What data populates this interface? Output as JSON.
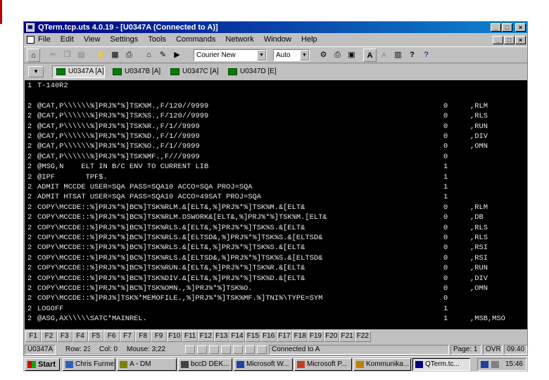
{
  "window": {
    "title": "QTerm.tcp.uts 4.0.19 - [U0347A (Connected to A)]",
    "menu": [
      "File",
      "Edit",
      "View",
      "Settings",
      "Tools",
      "Commands",
      "Network",
      "Window",
      "Help"
    ]
  },
  "toolbar": {
    "font_select": "Courier New",
    "size_select": "Auto"
  },
  "tabs": [
    "U0347A [A]",
    "U0347B [A]",
    "U0347C [A]",
    "U0347D [E]"
  ],
  "terminal_lines": [
    {
      "ln": "1",
      "cmd": "T-140R2",
      "c1": "",
      "c2": ""
    },
    {
      "ln": "",
      "cmd": "",
      "c1": "",
      "c2": ""
    },
    {
      "ln": "2",
      "cmd": "@CAT,P\\\\\\\\\\\\%]PRJ%*%]TSK%M.,F/120//9999",
      "c1": "0",
      "c2": ",RLM"
    },
    {
      "ln": "2",
      "cmd": "@CAT,P\\\\\\\\\\\\%]PRJ%*%]TSK%S.,F/120//9999",
      "c1": "0",
      "c2": ",RLS"
    },
    {
      "ln": "2",
      "cmd": "@CAT,P\\\\\\\\\\\\%]PRJ%*%]TSK%R.,F/1//9999",
      "c1": "0",
      "c2": ",RUN"
    },
    {
      "ln": "2",
      "cmd": "@CAT,P\\\\\\\\\\\\%]PRJ%*%]TSK%D.,F/1//9999",
      "c1": "0",
      "c2": ",DIV"
    },
    {
      "ln": "2",
      "cmd": "@CAT,P\\\\\\\\\\\\%]PRJ%*%]TSK%O.,F/1//9999",
      "c1": "0",
      "c2": ",OMN"
    },
    {
      "ln": "2",
      "cmd": "@CAT,P\\\\\\\\\\\\%]PRJ%*%]TSK%MF.,F///9999",
      "c1": "0",
      "c2": ""
    },
    {
      "ln": "2",
      "cmd": "@MSG,N    ELT IN B/C ENV TO CURRENT LIB",
      "c1": "1",
      "c2": ""
    },
    {
      "ln": "2",
      "cmd": "@IPF       TPF$.",
      "c1": "1",
      "c2": ""
    },
    {
      "ln": "2",
      "cmd": "ADMIT MCCDE USER=SQA PASS=SQA10 ACCO=SQA PROJ=SQA",
      "c1": "1",
      "c2": ""
    },
    {
      "ln": "2",
      "cmd": "ADMIT HTSAT USER=SQA PASS=SQA10 ACCO=49SAT PROJ=SQA",
      "c1": "1",
      "c2": ""
    },
    {
      "ln": "2",
      "cmd": "COPY\\MCCDE::%]PRJ%*%]BC%]TSK%RLM.&[ELT&,%]PRJ%*%]TSK%M.&[ELT&",
      "c1": "0",
      "c2": ",RLM"
    },
    {
      "ln": "2",
      "cmd": "COPY\\MCCDE::%]PRJ%*%]BC%]TSK%RLM.DSWORK&[ELT&,%]PRJ%*%]TSK%M.[ELT&",
      "c1": "0",
      "c2": ",DB"
    },
    {
      "ln": "2",
      "cmd": "COPY\\MCCDE::%]PRJ%*%]BC%]TSK%RLS.&[ELT&,%]PRJ%*%]TSK%S.&[ELT&",
      "c1": "0",
      "c2": ",RLS"
    },
    {
      "ln": "2",
      "cmd": "COPY\\MCCDE::%]PRJ%*%]BC%]TSK%RLS.&[ELTSD&,%]PRJ%*%]TSK%S.&[ELTSD&",
      "c1": "0",
      "c2": ",RLS"
    },
    {
      "ln": "2",
      "cmd": "COPY\\MCCDE::%]PRJ%*%]BC%]TSK%RLS.&[ELT&,%]PRJ%*%]TSK%S.&[ELT&",
      "c1": "0",
      "c2": ",RSI"
    },
    {
      "ln": "2",
      "cmd": "COPY\\MCCDE::%]PRJ%*%]BC%]TSK%RLS.&[ELTSD&,%]PRJ%*%]TSK%S.&[ELTSD&",
      "c1": "0",
      "c2": ",RSI"
    },
    {
      "ln": "2",
      "cmd": "COPY\\MCCDE::%]PRJ%*%]BC%]TSK%RUN.&[ELT&,%]PRJ%*%]TSK%R.&[ELT&",
      "c1": "0",
      "c2": ",RUN"
    },
    {
      "ln": "2",
      "cmd": "COPY\\MCCDE::%]PRJ%*%]BC%]TSK%DIV.&[ELT&,%]PRJ%*%]TSK%D.&[ELT&",
      "c1": "0",
      "c2": ",DIV"
    },
    {
      "ln": "2",
      "cmd": "COPY\\MCCDE::%]PRJ%*%]BC%]TSK%OMN.,%]PRJ%*%]TSK%O.",
      "c1": "0",
      "c2": ",OMN"
    },
    {
      "ln": "2",
      "cmd": "COPY\\MCCDE::%]PRJ%]TSK%*MEMOFILE.,%]PRJ%*%]TSK%MF.%]TNI%\\TYPE=SYM",
      "c1": "0",
      "c2": ""
    },
    {
      "ln": "2",
      "cmd": "LOGOFF",
      "c1": "1",
      "c2": ""
    },
    {
      "ln": "2",
      "cmd": "@ASG,AX\\\\\\\\\\SATC*MAINREL.",
      "c1": "1",
      "c2": ",MSB,MSO"
    }
  ],
  "fkeys": [
    "F1",
    "F2",
    "F3",
    "F4",
    "F5",
    "F6",
    "F7",
    "F8",
    "F9",
    "F10",
    "F11",
    "F12",
    "F13",
    "F14",
    "F15",
    "F16",
    "F17",
    "F18",
    "F19",
    "F20",
    "F21",
    "F22"
  ],
  "status": {
    "session": "U0347A",
    "row": "Row: 23",
    "col": "Col: 0",
    "mouse": "Mouse:  3;22",
    "connection": "Connected to A",
    "page": "Page: 1",
    "ovr": "OVR",
    "time": "09:40"
  },
  "taskbar": {
    "start": "Start",
    "tasks": [
      "Chris Furme...",
      "A - DM",
      "bccD DEK...",
      "Microsoft W...",
      "Microsoft P...",
      "Kommunika...",
      "QTerm.tc..."
    ],
    "clock": "15:46"
  }
}
